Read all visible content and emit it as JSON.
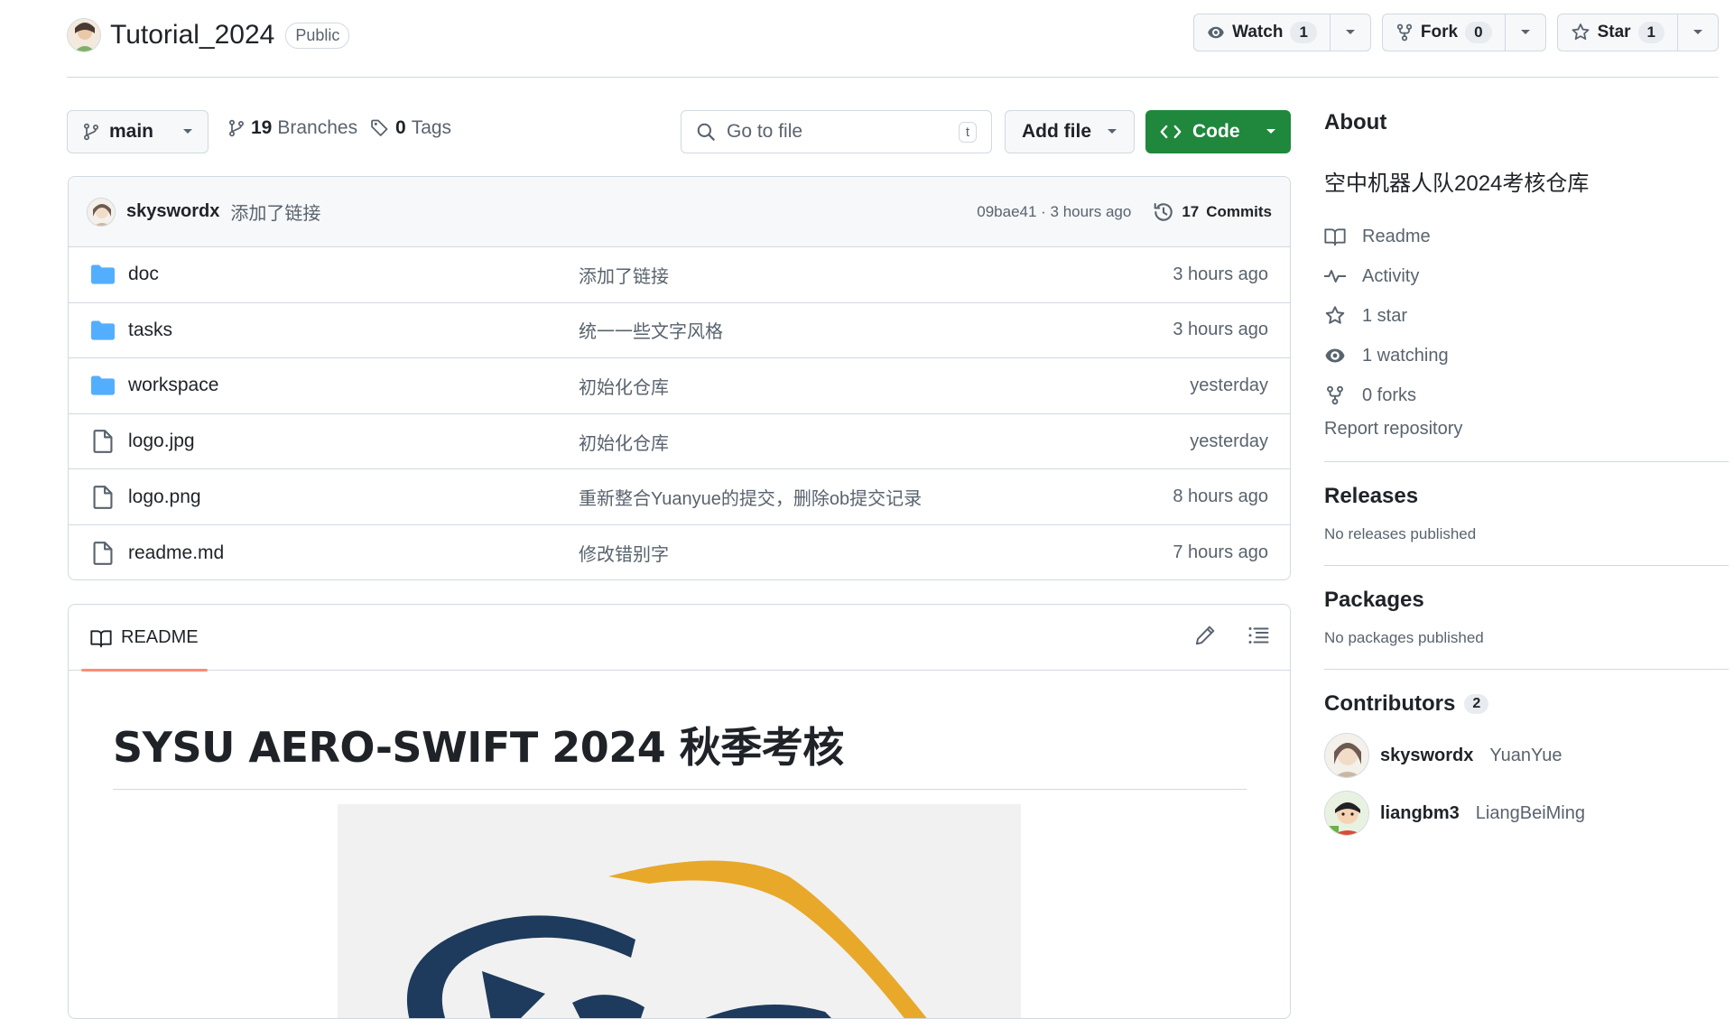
{
  "repo": {
    "name": "Tutorial_2024",
    "visibility": "Public",
    "watch_label": "Watch",
    "watch_count": "1",
    "fork_label": "Fork",
    "fork_count": "0",
    "star_label": "Star",
    "star_count": "1"
  },
  "nav": {
    "branch": "main",
    "branches_count": "19",
    "branches_label": "Branches",
    "tags_count": "0",
    "tags_label": "Tags",
    "goto_placeholder": "Go to file",
    "goto_shortcut": "t",
    "add_file_label": "Add file",
    "code_label": "Code"
  },
  "latest_commit": {
    "author": "skyswordx",
    "message": "添加了链接",
    "hash_time": "09bae41 · 3 hours ago",
    "commits_count": "17",
    "commits_label": "Commits"
  },
  "files": [
    {
      "name": "doc",
      "type": "folder",
      "message": "添加了链接",
      "time": "3 hours ago"
    },
    {
      "name": "tasks",
      "type": "folder",
      "message": "统一一些文字风格",
      "time": "3 hours ago"
    },
    {
      "name": "workspace",
      "type": "folder",
      "message": "初始化仓库",
      "time": "yesterday"
    },
    {
      "name": "logo.jpg",
      "type": "file",
      "message": "初始化仓库",
      "time": "yesterday"
    },
    {
      "name": "logo.png",
      "type": "file",
      "message": "重新整合Yuanyue的提交，删除ob提交记录",
      "time": "8 hours ago"
    },
    {
      "name": "readme.md",
      "type": "file",
      "message": "修改错别字",
      "time": "7 hours ago"
    }
  ],
  "readme": {
    "tab_label": "README",
    "heading": "SYSU AERO-SWIFT 2024 秋季考核"
  },
  "about": {
    "title": "About",
    "description": "空中机器人队2024考核仓库",
    "items": [
      {
        "icon": "book-icon",
        "label": "Readme"
      },
      {
        "icon": "pulse-icon",
        "label": "Activity"
      },
      {
        "icon": "star-icon",
        "label": "1 star"
      },
      {
        "icon": "eye-icon",
        "label": "1 watching"
      },
      {
        "icon": "fork-icon",
        "label": "0 forks"
      }
    ],
    "report": "Report repository"
  },
  "releases": {
    "title": "Releases",
    "note": "No releases published"
  },
  "packages": {
    "title": "Packages",
    "note": "No packages published"
  },
  "contributors": {
    "title": "Contributors",
    "count": "2",
    "list": [
      {
        "login": "skyswordx",
        "name": "YuanYue"
      },
      {
        "login": "liangbm3",
        "name": "LiangBeiMing"
      }
    ]
  },
  "colors": {
    "accent_green": "#1f883d",
    "folder_blue": "#54aeff",
    "tab_underline": "#fd8c73",
    "logo_navy": "#1e3a5c",
    "logo_gold": "#e8a82a"
  }
}
